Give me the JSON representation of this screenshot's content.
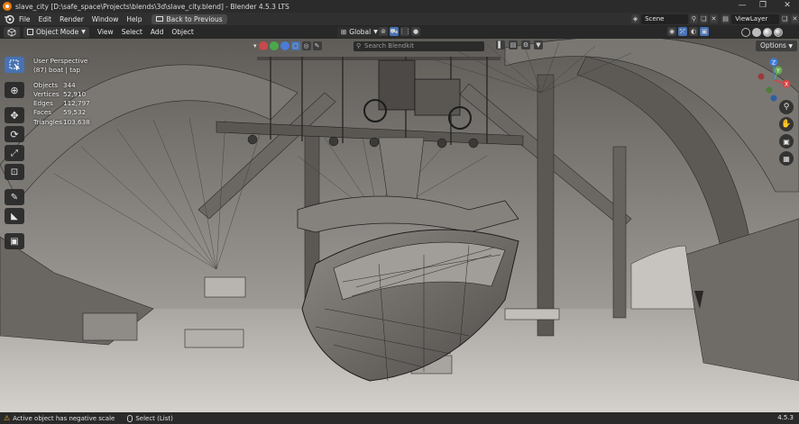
{
  "window": {
    "title": "slave_city [D:\\safe_space\\Projects\\blends\\3d\\slave_city.blend] - Blender 4.5.3 LTS",
    "controls": [
      "—",
      "❐",
      "✕"
    ]
  },
  "menubar": {
    "items": [
      "File",
      "Edit",
      "Render",
      "Window",
      "Help"
    ],
    "back_button": "Back to Previous",
    "scene": "Scene",
    "view_layer": "ViewLayer"
  },
  "header": {
    "mode": "Object Mode",
    "menus": [
      "View",
      "Select",
      "Add",
      "Object"
    ],
    "transform_orientation": "Global",
    "search_placeholder": "Search Blendkit",
    "options": "Options"
  },
  "viewport": {
    "perspective": "User Perspective",
    "context": "(87) boat | tap",
    "stats": [
      {
        "label": "Objects",
        "value": "344"
      },
      {
        "label": "Vertices",
        "value": "52,910"
      },
      {
        "label": "Edges",
        "value": "112,797"
      },
      {
        "label": "Faces",
        "value": "59,532"
      },
      {
        "label": "Triangles",
        "value": "103,638"
      }
    ],
    "gizmo_axes": [
      "X",
      "Y",
      "Z"
    ],
    "version": "4.5.3"
  },
  "statusbar": {
    "warning": "Active object has negative scale",
    "select_hint": "Select (List)"
  },
  "colors": {
    "accent": "#4772b3",
    "axis_x": "#d64545",
    "axis_y": "#6aa84f",
    "axis_z": "#3f7fd8",
    "blender_orange": "#e87d0d"
  }
}
